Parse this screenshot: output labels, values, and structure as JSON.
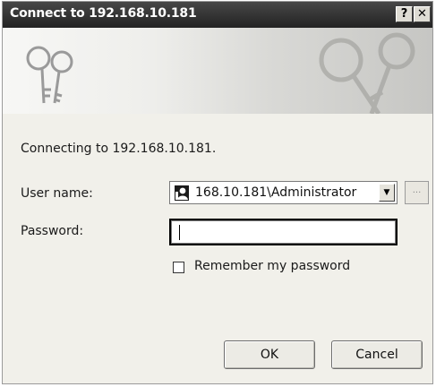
{
  "window": {
    "title": "Connect to 192.168.10.181",
    "help_glyph": "?",
    "close_glyph": "✕",
    "title_bar_color": "#2d2d2d"
  },
  "banner": {
    "icon": "keys-icon"
  },
  "main": {
    "connecting_text": "Connecting to 192.168.10.181.",
    "username_label": "User name:",
    "username_value": "168.10.181\\Administrator",
    "username_icon": "user-icon",
    "dropdown_glyph": "▼",
    "browse_label": "...",
    "password_label": "Password:",
    "password_value": "",
    "remember_label": "Remember my password",
    "remember_checked": false
  },
  "buttons": {
    "ok": "OK",
    "cancel": "Cancel"
  }
}
